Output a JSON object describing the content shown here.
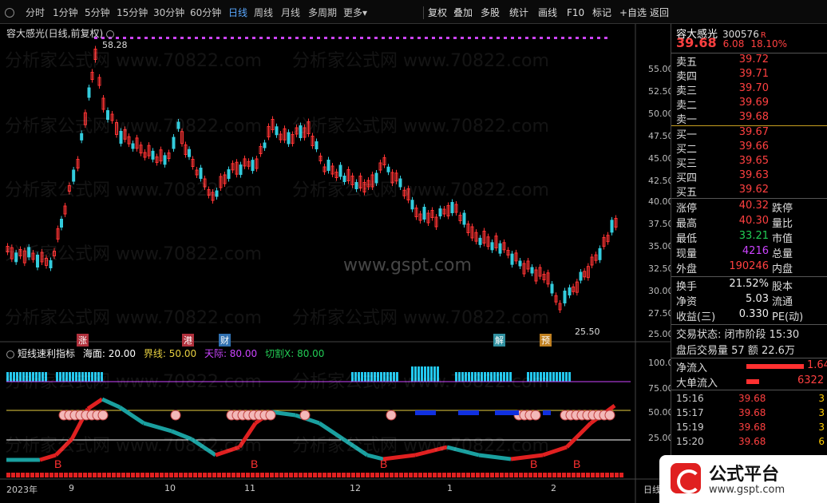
{
  "toolbar": {
    "periods": [
      "分时",
      "1分钟",
      "5分钟",
      "15分钟",
      "30分钟",
      "60分钟",
      "日线",
      "周线",
      "月线",
      "多周期",
      "更多"
    ],
    "active_period": "日线",
    "more_suffix": "▾",
    "tools": [
      "复权",
      "叠加",
      "多股",
      "统计",
      "画线",
      "F10",
      "标记",
      "+自选",
      "返回"
    ]
  },
  "chart": {
    "title": "容大感光(日线,前复权)",
    "high_label": "58.28",
    "low_label": "25.50",
    "price_ticks": [
      "55.00",
      "52.50",
      "50.00",
      "47.50",
      "45.00",
      "42.50",
      "40.00",
      "37.50",
      "35.00",
      "32.50",
      "30.00",
      "27.50",
      "25.00"
    ],
    "events": [
      {
        "text": "涨",
        "color": "#b0303c"
      },
      {
        "text": "港",
        "color": "#b0303c"
      },
      {
        "text": "财",
        "color": "#3070b0"
      },
      {
        "text": "解",
        "color": "#3090a0"
      },
      {
        "text": "预",
        "color": "#c08020"
      }
    ],
    "watermark_text": "分析家公式网 www.70822.com",
    "watermark_url": "www.gspt.com"
  },
  "indicator": {
    "name": "短线速利指标",
    "params": [
      {
        "label": "海面: 20.00",
        "color": "#ffffff"
      },
      {
        "label": "界线: 50.00",
        "color": "#e8d040"
      },
      {
        "label": "天际: 80.00",
        "color": "#cc44ff"
      },
      {
        "label": "切割X: 80.00",
        "color": "#22cc55"
      }
    ],
    "axis_ticks": [
      "100.0",
      "75.00",
      "50.00",
      "25.00"
    ],
    "buy_marker": "B"
  },
  "dates": [
    "2023年",
    "9",
    "10",
    "11",
    "12",
    "1",
    "2",
    "日线"
  ],
  "quote": {
    "name": "容大感光",
    "code": "300576",
    "flag": "R",
    "price": "39.68",
    "change": "6.08",
    "pct": "18.10%",
    "asks": [
      {
        "label": "卖五",
        "price": "39.72"
      },
      {
        "label": "卖四",
        "price": "39.71"
      },
      {
        "label": "卖三",
        "price": "39.70"
      },
      {
        "label": "卖二",
        "price": "39.69"
      },
      {
        "label": "卖一",
        "price": "39.68"
      }
    ],
    "bids": [
      {
        "label": "买一",
        "price": "39.67"
      },
      {
        "label": "买二",
        "price": "39.66"
      },
      {
        "label": "买三",
        "price": "39.65"
      },
      {
        "label": "买四",
        "price": "39.63"
      },
      {
        "label": "买五",
        "price": "39.62"
      }
    ],
    "stats": [
      {
        "label": "涨停",
        "value": "40.32",
        "label2": "跌停",
        "color": "red"
      },
      {
        "label": "最高",
        "value": "40.30",
        "label2": "量比",
        "color": "red"
      },
      {
        "label": "最低",
        "value": "33.21",
        "label2": "市值",
        "color": "green"
      },
      {
        "label": "现量",
        "value": "4216",
        "label2": "总量",
        "color": "purple"
      },
      {
        "label": "外盘",
        "value": "190246",
        "label2": "内盘",
        "color": "red"
      }
    ],
    "stats2": [
      {
        "label": "换手",
        "value": "21.52%",
        "label2": "股本"
      },
      {
        "label": "净资",
        "value": "5.03",
        "label2": "流通"
      },
      {
        "label": "收益(三)",
        "value": "0.330",
        "label2": "PE(动)"
      }
    ],
    "trade_state": "交易状态: 闭市阶段 15:30",
    "after_hours": "盘后交易量 57 额 22.6万",
    "net_inflow_label": "净流入",
    "net_inflow_value": "1.64",
    "big_inflow_label": "大单流入",
    "big_inflow_value": "6322",
    "ticks": [
      {
        "time": "15:16",
        "price": "39.68",
        "vol": "3"
      },
      {
        "time": "15:17",
        "price": "39.68",
        "vol": "3"
      },
      {
        "time": "15:19",
        "price": "39.68",
        "vol": "3"
      },
      {
        "time": "15:20",
        "price": "39.68",
        "vol": "6"
      }
    ]
  },
  "logo": {
    "title": "公式平台",
    "url": "www.gspt.com"
  }
}
